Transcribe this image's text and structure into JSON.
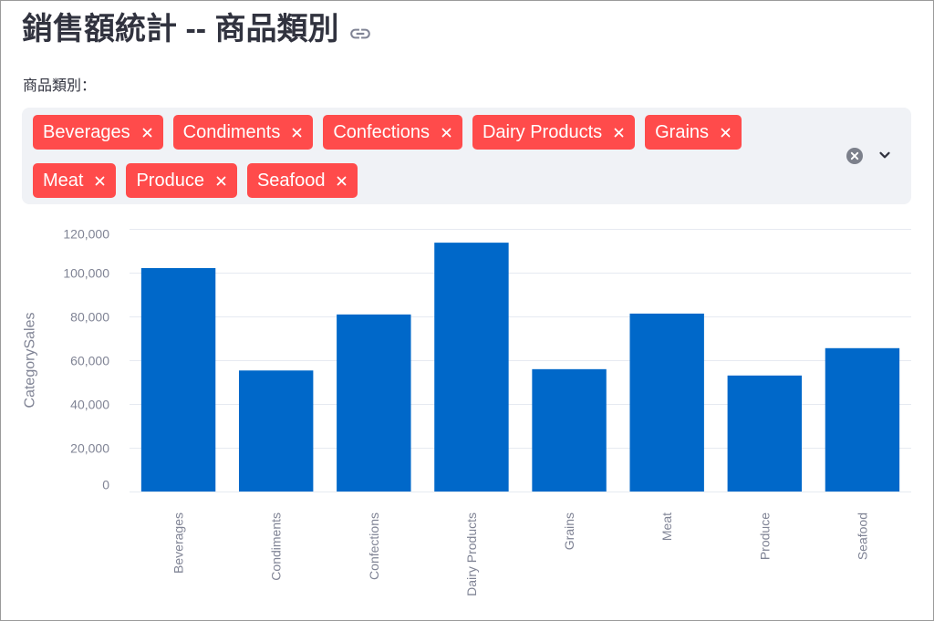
{
  "header": {
    "title": "銷售額統計 -- 商品類別",
    "anchor_icon": "link-icon"
  },
  "filter": {
    "label": "商品類別：",
    "selected": [
      "Beverages",
      "Condiments",
      "Confections",
      "Dairy Products",
      "Grains",
      "Meat",
      "Produce",
      "Seafood"
    ],
    "remove_icon": "close-icon",
    "clear_icon": "clear-all-icon",
    "dropdown_icon": "chevron-down-icon"
  },
  "colors": {
    "accent": "#FF4B4B",
    "bar": "#0068C9",
    "widget_background": "#F0F2F6",
    "text": "#31333F",
    "axis_text": "#808495"
  },
  "chart_data": {
    "type": "bar",
    "categories": [
      "Beverages",
      "Condiments",
      "Confections",
      "Dairy Products",
      "Grains",
      "Meat",
      "Produce",
      "Seafood"
    ],
    "values": [
      102100,
      55300,
      80900,
      113700,
      55900,
      81300,
      53000,
      65500
    ],
    "title": "",
    "xlabel": "",
    "ylabel": "CategorySales",
    "ylim": [
      0,
      120000
    ],
    "yticks": [
      0,
      20000,
      40000,
      60000,
      80000,
      100000,
      120000
    ],
    "ytick_labels": [
      "0",
      "20,000",
      "40,000",
      "60,000",
      "80,000",
      "100,000",
      "120,000"
    ],
    "grid": true,
    "legend": "none"
  }
}
